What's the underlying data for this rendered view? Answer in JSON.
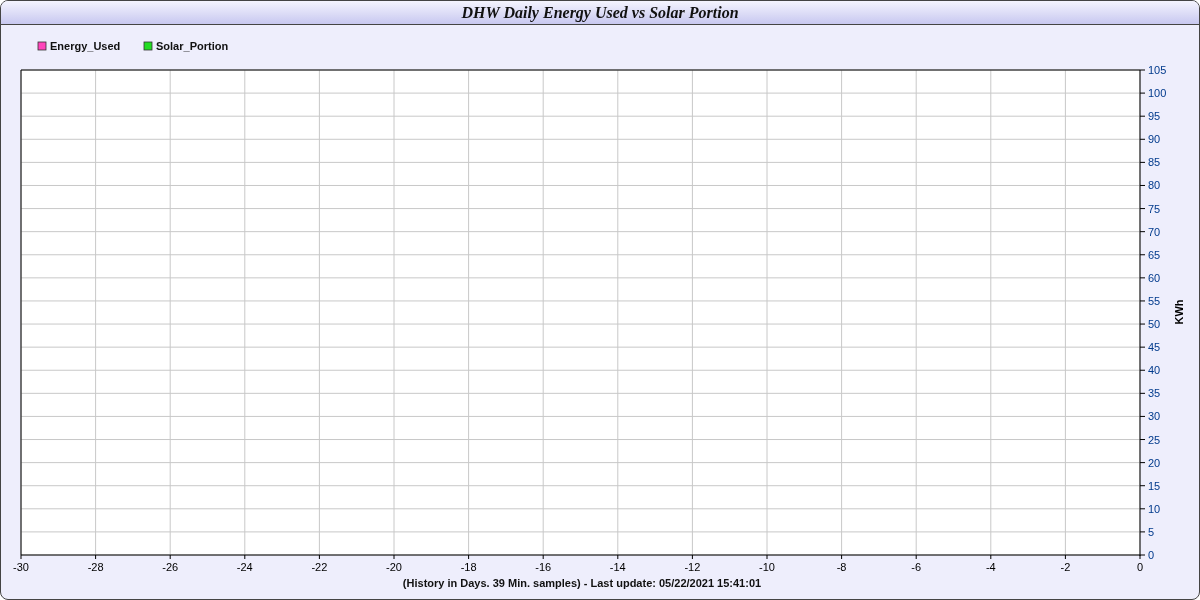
{
  "title": "DHW Daily Energy Used vs Solar Portion",
  "chart": {
    "chart_data": {
      "type": "line",
      "xlabel": "(History in Days. 39 Min. samples) - Last update: 05/22/2021 15:41:01",
      "ylabel": "KWh",
      "series": [
        {
          "name": "Energy_Used",
          "color": "#ff44bb",
          "values": [
            null,
            null,
            null,
            null,
            null,
            null,
            null,
            null,
            null,
            null,
            null,
            null,
            null,
            null,
            null,
            null
          ]
        },
        {
          "name": "Solar_Portion",
          "color": "#22dd22",
          "values": [
            null,
            null,
            null,
            null,
            null,
            null,
            null,
            null,
            null,
            null,
            null,
            null,
            null,
            null,
            null,
            null
          ]
        }
      ],
      "categories": [
        "-30",
        "-28",
        "-26",
        "-24",
        "-22",
        "-20",
        "-18",
        "-16",
        "-14",
        "-12",
        "-10",
        "-8",
        "-6",
        "-4",
        "-2",
        "0"
      ],
      "grid": true,
      "ylim": [
        0,
        105
      ],
      "yticks": [
        0,
        5,
        10,
        15,
        20,
        25,
        30,
        35,
        40,
        45,
        50,
        55,
        60,
        65,
        70,
        75,
        80,
        85,
        90,
        95,
        100,
        105
      ]
    }
  }
}
